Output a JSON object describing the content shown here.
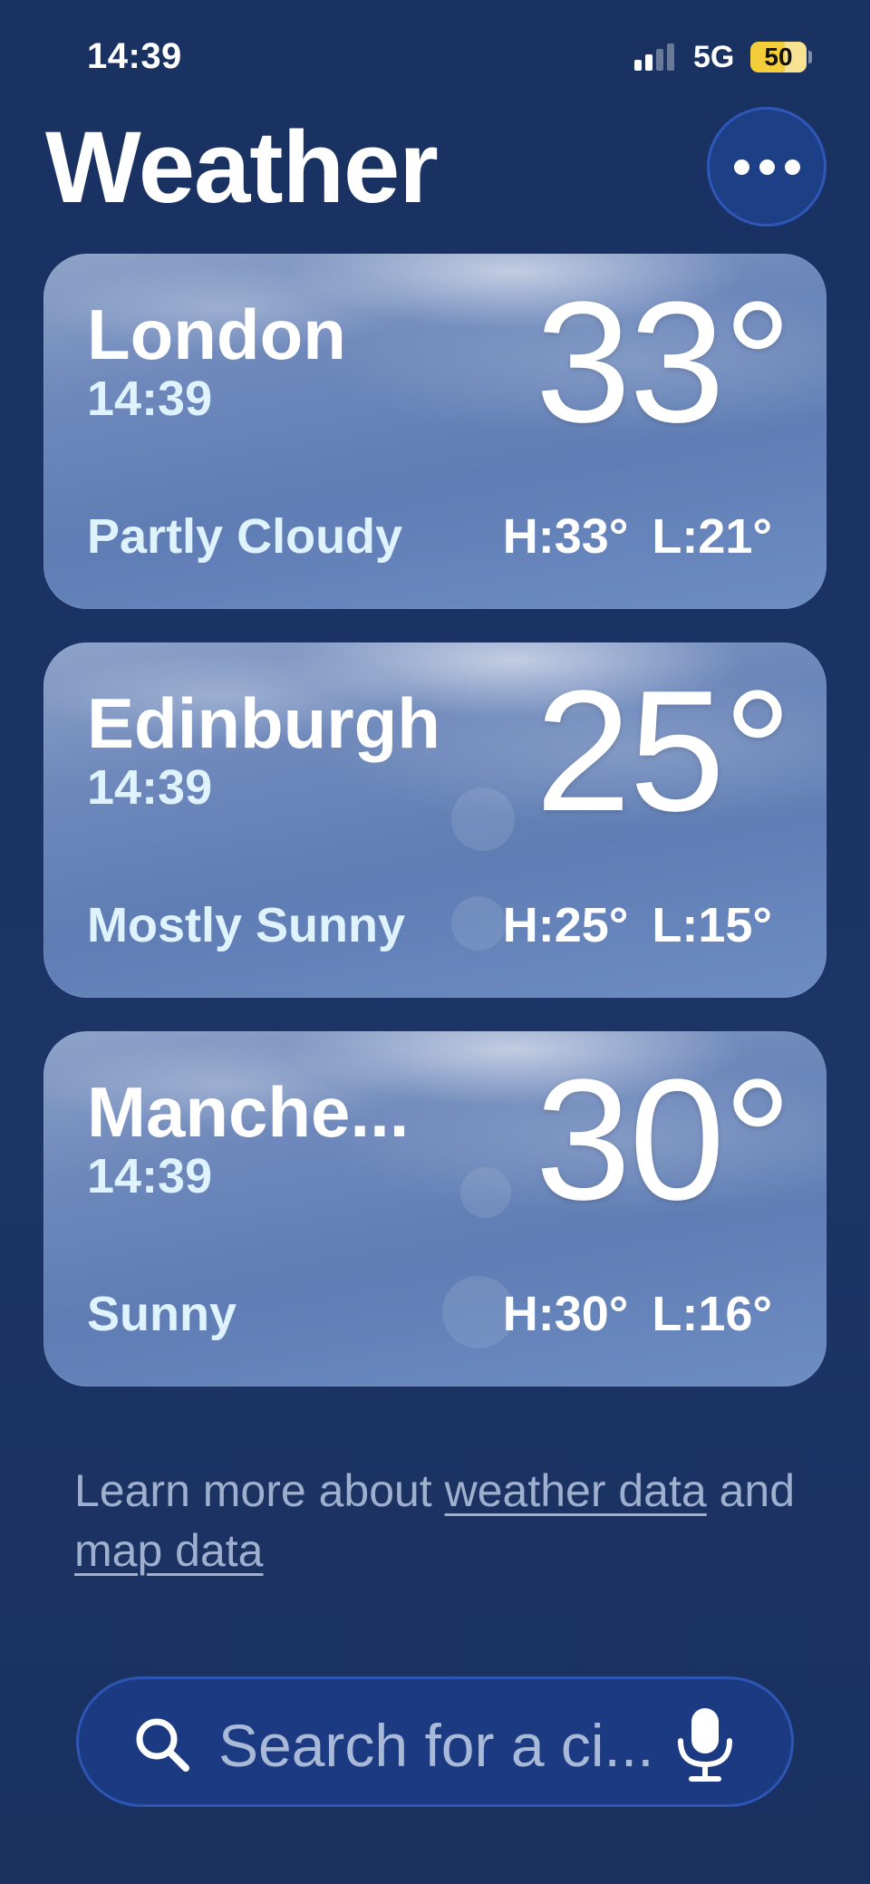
{
  "status_bar": {
    "time": "14:39",
    "network": "5G",
    "battery": "50"
  },
  "header": {
    "title": "Weather",
    "more_icon": "ellipsis-icon"
  },
  "cities": [
    {
      "name": "London",
      "time": "14:39",
      "temp": "33°",
      "condition": "Partly Cloudy",
      "high": "H:33°",
      "low": "L:21°"
    },
    {
      "name": "Edinburgh",
      "time": "14:39",
      "temp": "25°",
      "condition": "Mostly Sunny",
      "high": "H:25°",
      "low": "L:15°"
    },
    {
      "name": "Manche...",
      "time": "14:39",
      "temp": "30°",
      "condition": "Sunny",
      "high": "H:30°",
      "low": "L:16°"
    }
  ],
  "footer": {
    "prefix": "Learn more about ",
    "weather_link": "weather data",
    "middle": " and ",
    "map_link": "map data"
  },
  "search": {
    "placeholder": "Search for a ci...",
    "search_icon": "search-icon",
    "mic_icon": "microphone-icon"
  },
  "colors": {
    "background": "#1b3263",
    "accent_button": "#1d3f86",
    "card": "#6e88bb",
    "battery": "#f3cd3a"
  }
}
